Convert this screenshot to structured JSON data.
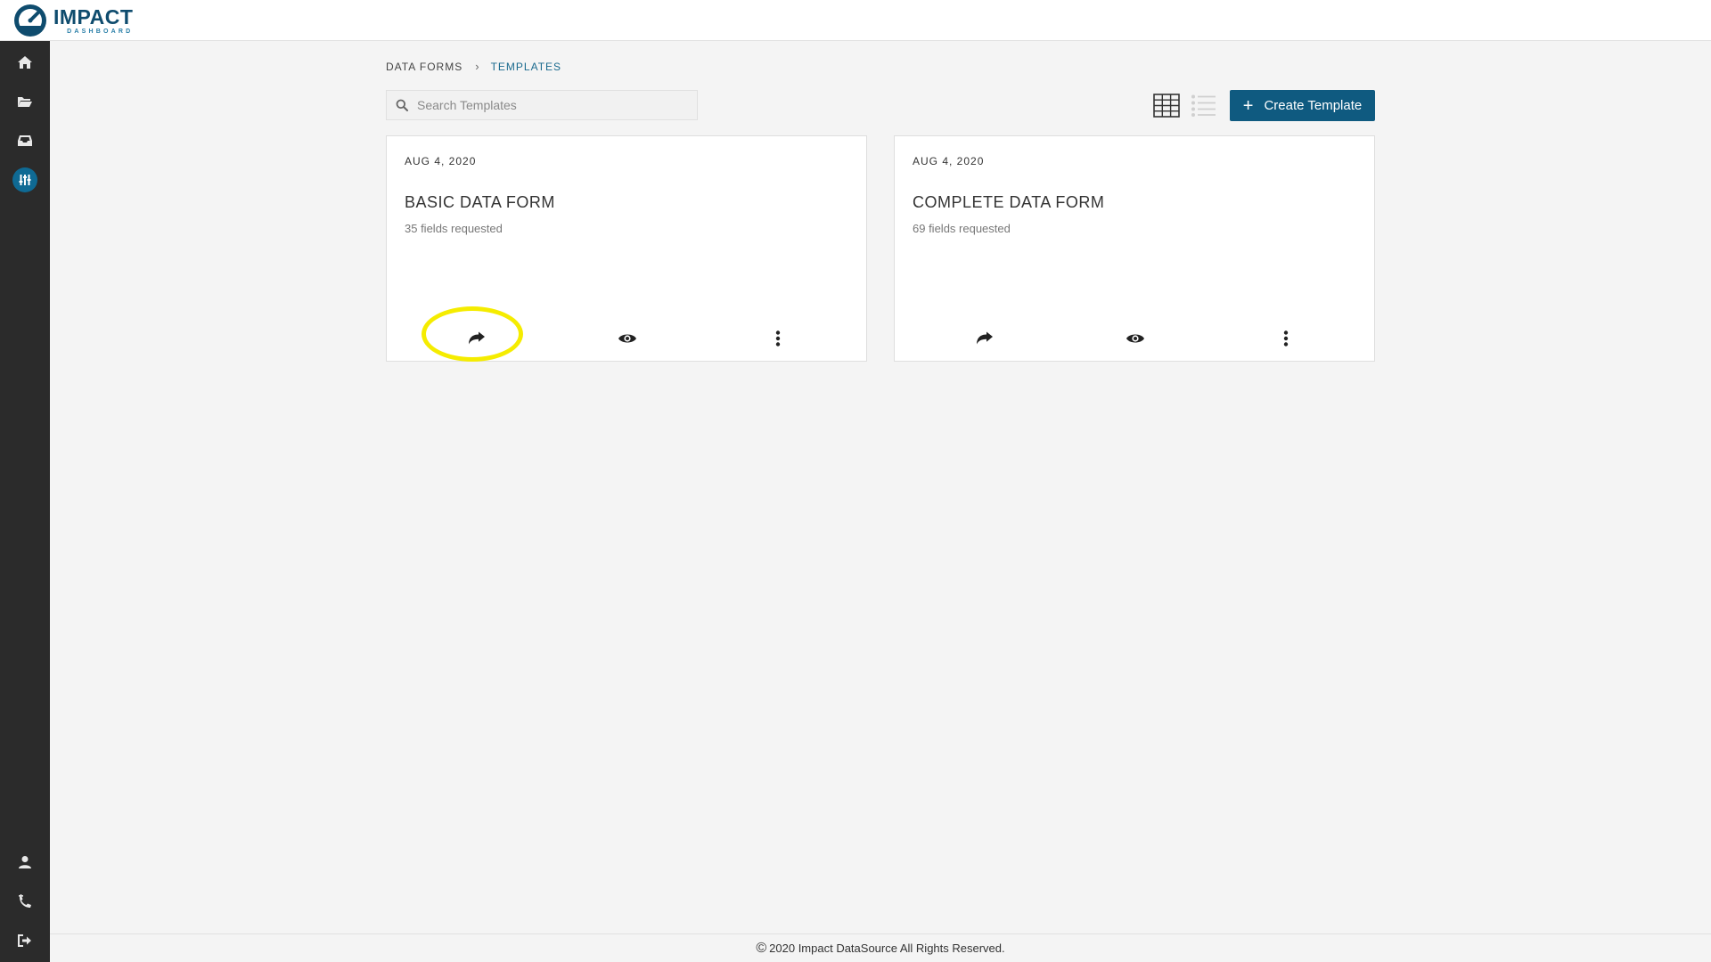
{
  "app": {
    "logo_name": "IMPACT",
    "logo_sub": "DASHBOARD"
  },
  "sidebar": {
    "top_items": [
      {
        "icon": "home-icon"
      },
      {
        "icon": "folder-open-icon"
      },
      {
        "icon": "inbox-icon"
      },
      {
        "icon": "sliders-icon",
        "active": true
      }
    ],
    "bottom_items": [
      {
        "icon": "user-icon"
      },
      {
        "icon": "phone-icon"
      },
      {
        "icon": "sign-out-icon"
      }
    ]
  },
  "breadcrumb": {
    "items": [
      "DATA FORMS",
      "TEMPLATES"
    ],
    "separator": "›"
  },
  "search": {
    "placeholder": "Search Templates",
    "value": ""
  },
  "toolbar": {
    "create_label": "Create Template",
    "create_icon": "+",
    "active_view": "grid"
  },
  "templates": [
    {
      "date": "AUG 4, 2020",
      "title": "BASIC DATA FORM",
      "fields": "35 fields requested"
    },
    {
      "date": "AUG 4, 2020",
      "title": "COMPLETE DATA FORM",
      "fields": "69 fields requested"
    }
  ],
  "footer": {
    "copyright_symbol": "©",
    "text": "2020 Impact DataSource All Rights Reserved."
  },
  "colors": {
    "brand": "#0f4c6e",
    "accent": "#0f5a80",
    "sidebar": "#2b2b2b",
    "highlight": "#f5ec00"
  }
}
